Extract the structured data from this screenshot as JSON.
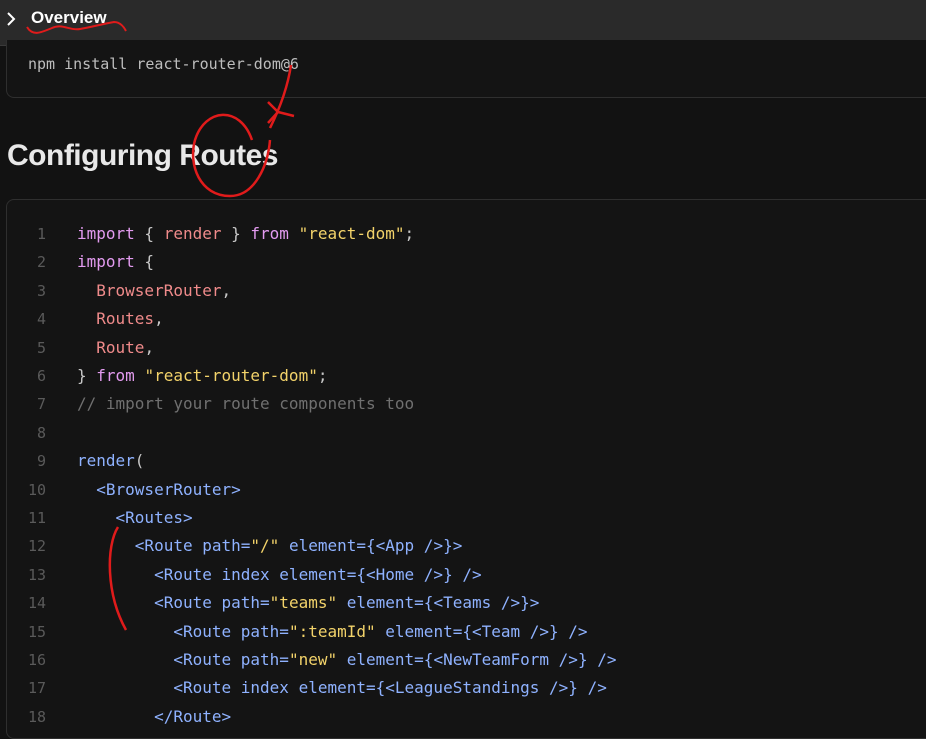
{
  "header": {
    "title": "Overview"
  },
  "install": {
    "command": "npm install react-router-dom@6"
  },
  "section": {
    "heading": "Configuring Routes"
  },
  "code": {
    "line_numbers": [
      "1",
      "2",
      "3",
      "4",
      "5",
      "6",
      "7",
      "8",
      "9",
      "10",
      "11",
      "12",
      "13",
      "14",
      "15",
      "16",
      "17",
      "18"
    ],
    "lines": [
      [
        {
          "t": "import",
          "c": "kw"
        },
        {
          "t": " { ",
          "c": "punc"
        },
        {
          "t": "render",
          "c": "id"
        },
        {
          "t": " } ",
          "c": "punc"
        },
        {
          "t": "from",
          "c": "kw"
        },
        {
          "t": " ",
          "c": "punc"
        },
        {
          "t": "\"react-dom\"",
          "c": "str"
        },
        {
          "t": ";",
          "c": "punc"
        }
      ],
      [
        {
          "t": "import",
          "c": "kw"
        },
        {
          "t": " {",
          "c": "punc"
        }
      ],
      [
        {
          "t": "  BrowserRouter",
          "c": "id"
        },
        {
          "t": ",",
          "c": "punc"
        }
      ],
      [
        {
          "t": "  Routes",
          "c": "id"
        },
        {
          "t": ",",
          "c": "punc"
        }
      ],
      [
        {
          "t": "  Route",
          "c": "id"
        },
        {
          "t": ",",
          "c": "punc"
        }
      ],
      [
        {
          "t": "} ",
          "c": "punc"
        },
        {
          "t": "from",
          "c": "kw"
        },
        {
          "t": " ",
          "c": "punc"
        },
        {
          "t": "\"react-router-dom\"",
          "c": "str"
        },
        {
          "t": ";",
          "c": "punc"
        }
      ],
      [
        {
          "t": "// import your route components too",
          "c": "com"
        }
      ],
      [],
      [
        {
          "t": "render",
          "c": "fn"
        },
        {
          "t": "(",
          "c": "punc"
        }
      ],
      [
        {
          "t": "  <BrowserRouter>",
          "c": "tag"
        }
      ],
      [
        {
          "t": "    <Routes>",
          "c": "tag"
        }
      ],
      [
        {
          "t": "      <Route ",
          "c": "tag"
        },
        {
          "t": "path=",
          "c": "tag"
        },
        {
          "t": "\"/\"",
          "c": "str"
        },
        {
          "t": " element={",
          "c": "tag"
        },
        {
          "t": "<App />",
          "c": "tag"
        },
        {
          "t": "}>",
          "c": "tag"
        }
      ],
      [
        {
          "t": "        <Route ",
          "c": "tag"
        },
        {
          "t": "index element={",
          "c": "tag"
        },
        {
          "t": "<Home />",
          "c": "tag"
        },
        {
          "t": "} />",
          "c": "tag"
        }
      ],
      [
        {
          "t": "        <Route ",
          "c": "tag"
        },
        {
          "t": "path=",
          "c": "tag"
        },
        {
          "t": "\"teams\"",
          "c": "str"
        },
        {
          "t": " element={",
          "c": "tag"
        },
        {
          "t": "<Teams />",
          "c": "tag"
        },
        {
          "t": "}>",
          "c": "tag"
        }
      ],
      [
        {
          "t": "          <Route ",
          "c": "tag"
        },
        {
          "t": "path=",
          "c": "tag"
        },
        {
          "t": "\":teamId\"",
          "c": "str"
        },
        {
          "t": " element={",
          "c": "tag"
        },
        {
          "t": "<Team />",
          "c": "tag"
        },
        {
          "t": "} />",
          "c": "tag"
        }
      ],
      [
        {
          "t": "          <Route ",
          "c": "tag"
        },
        {
          "t": "path=",
          "c": "tag"
        },
        {
          "t": "\"new\"",
          "c": "str"
        },
        {
          "t": " element={",
          "c": "tag"
        },
        {
          "t": "<NewTeamForm />",
          "c": "tag"
        },
        {
          "t": "} />",
          "c": "tag"
        }
      ],
      [
        {
          "t": "          <Route ",
          "c": "tag"
        },
        {
          "t": "index element={",
          "c": "tag"
        },
        {
          "t": "<LeagueStandings />",
          "c": "tag"
        },
        {
          "t": "} />",
          "c": "tag"
        }
      ],
      [
        {
          "t": "        </Route>",
          "c": "tag"
        }
      ]
    ]
  },
  "icons": {
    "header_toggle": "chevron-right-icon"
  },
  "colors": {
    "annotation": "#e01b1b",
    "keyword": "#e39bf0",
    "string": "#f3d36a",
    "identifier": "#f08b8b",
    "tag": "#8fb2ff",
    "comment": "#707070"
  }
}
